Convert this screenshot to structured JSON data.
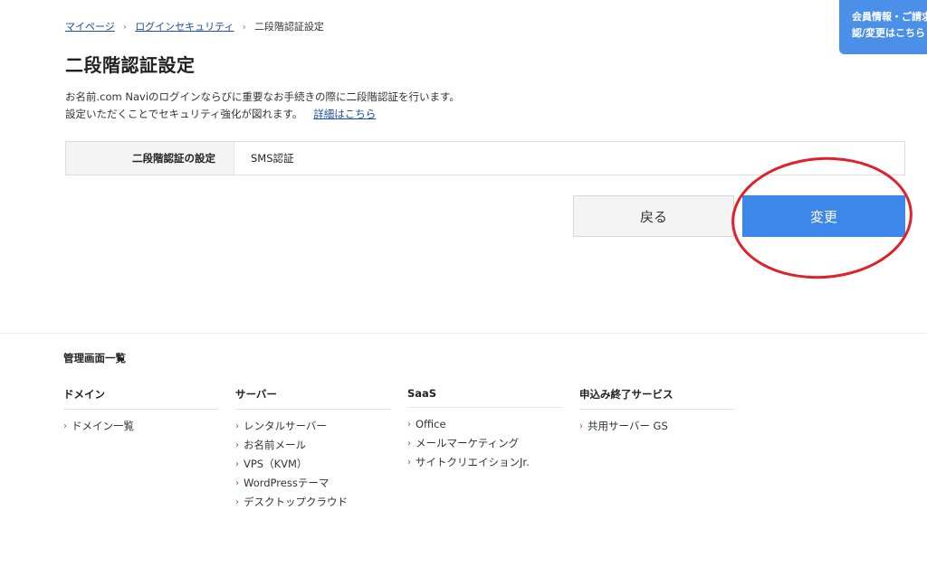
{
  "breadcrumb": {
    "items": [
      "マイページ",
      "ログインセキュリティ",
      "二段階認証設定"
    ],
    "separator": "›"
  },
  "page_title": "二段階認証設定",
  "description": {
    "line1": "お名前.com Naviのログインならびに重要なお手続きの際に二段階認証を行います。",
    "line2": "設定いただくことでセキュリティ強化が図れます。",
    "link": "詳細はこちら"
  },
  "setting": {
    "label": "二段階認証の設定",
    "value": "SMS認証"
  },
  "buttons": {
    "back": "戻る",
    "change": "変更"
  },
  "member_panel": {
    "line1": "会員情報・ご請求",
    "line2": "認/変更はこちら"
  },
  "footer": {
    "title": "管理画面一覧",
    "columns": [
      {
        "heading": "ドメイン",
        "items": [
          "ドメイン一覧"
        ]
      },
      {
        "heading": "サーバー",
        "items": [
          "レンタルサーバー",
          "お名前メール",
          "VPS（KVM）",
          "WordPressテーマ",
          "デスクトップクラウド"
        ]
      },
      {
        "heading": "SaaS",
        "items": [
          "Office",
          "メールマーケティング",
          "サイトクリエイションJr."
        ]
      },
      {
        "heading": "申込み終了サービス",
        "items": [
          "共用サーバー GS"
        ]
      }
    ]
  },
  "colors": {
    "primary_button": "#3d86ea",
    "annotation_circle": "#e0202a",
    "link": "#1a4ea3",
    "chevron": "#d0342c"
  }
}
